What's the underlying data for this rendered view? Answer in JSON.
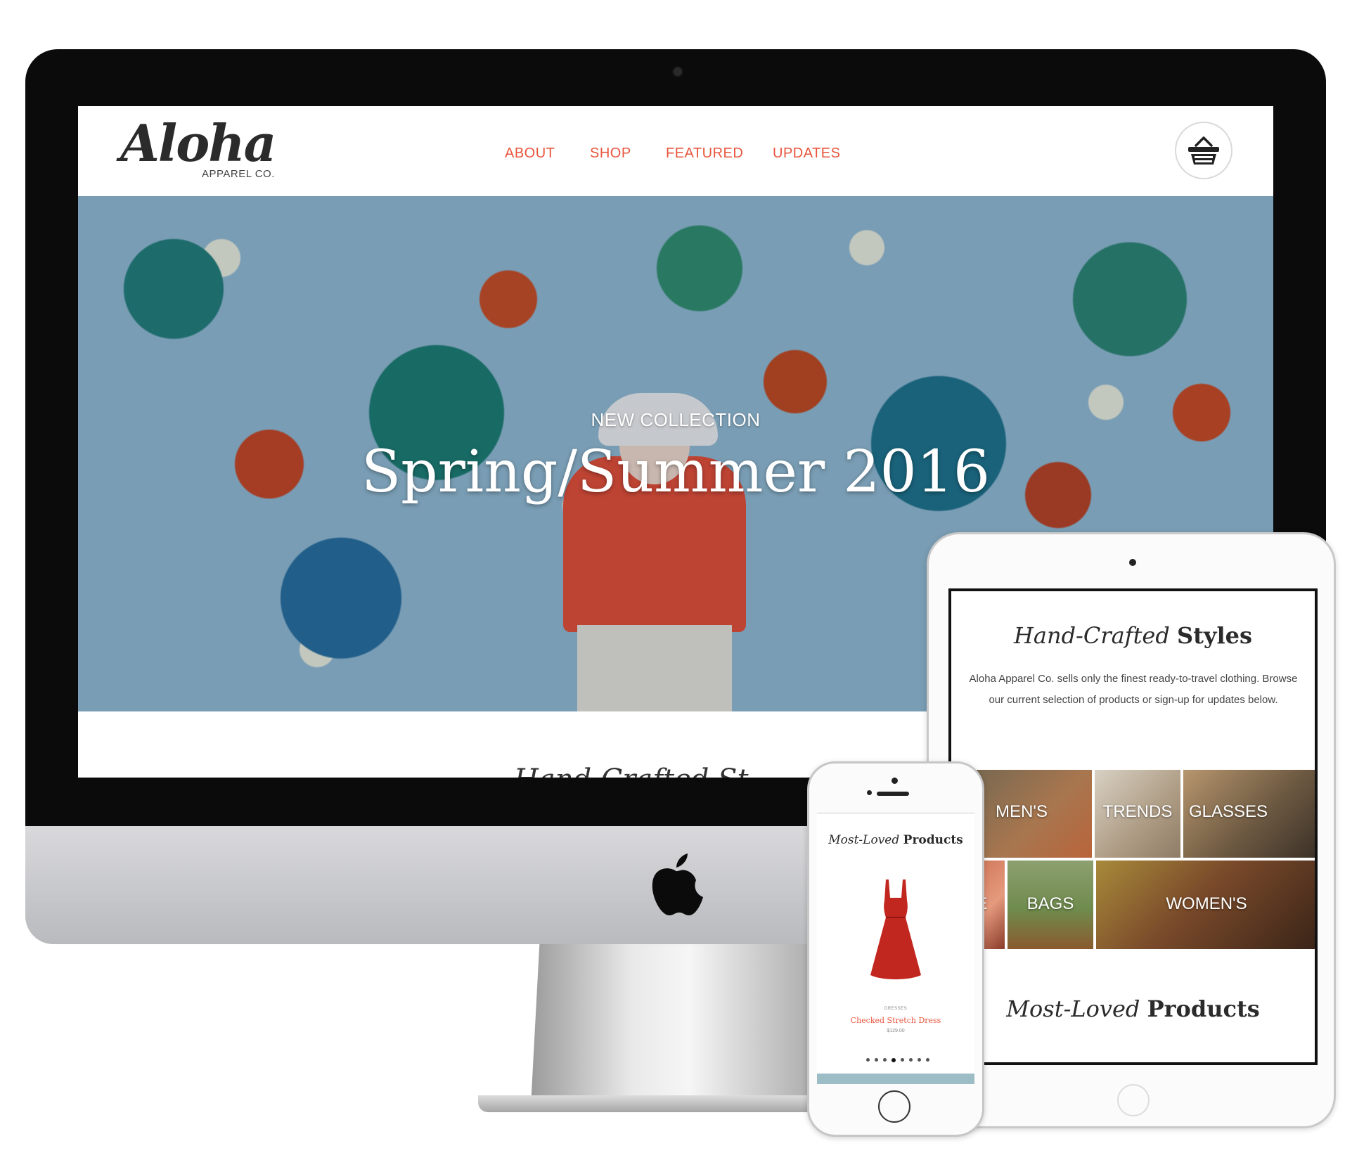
{
  "desktop": {
    "logo": {
      "script": "Aloha",
      "subtitle": "APPAREL CO."
    },
    "nav": [
      {
        "label": "ABOUT"
      },
      {
        "label": "SHOP"
      },
      {
        "label": "FEATURED"
      },
      {
        "label": "UPDATES"
      }
    ],
    "cart_icon": "basket-icon",
    "hero": {
      "kicker": "NEW COLLECTION",
      "title": "Spring/Summer 2016"
    },
    "below_fold_peek": "Hand-Crafted St"
  },
  "tablet": {
    "heading_italic": "Hand-Crafted",
    "heading_bold": "Styles",
    "description": "Aloha Apparel Co. sells only the finest ready-to-travel clothing. Browse our current selection of products or sign-up for updates below.",
    "tiles": [
      {
        "label": "MEN'S"
      },
      {
        "label": "TRENDS"
      },
      {
        "label": "GLASSES"
      },
      {
        "label": "ALE"
      },
      {
        "label": "BAGS"
      },
      {
        "label": "WOMEN'S"
      }
    ],
    "products_italic": "Most-Loved",
    "products_bold": "Products"
  },
  "phone": {
    "heading_italic": "Most-Loved",
    "heading_bold": "Products",
    "product": {
      "category": "DRESSES",
      "name": "Checked Stretch Dress",
      "price": "$129.00"
    },
    "carousel": {
      "count": 8,
      "active": 3
    }
  },
  "colors": {
    "accent": "#e8553d",
    "text_dark": "#2b2b2b",
    "hero_bg": "#8fb7cf",
    "bezel": "#0b0b0b"
  }
}
